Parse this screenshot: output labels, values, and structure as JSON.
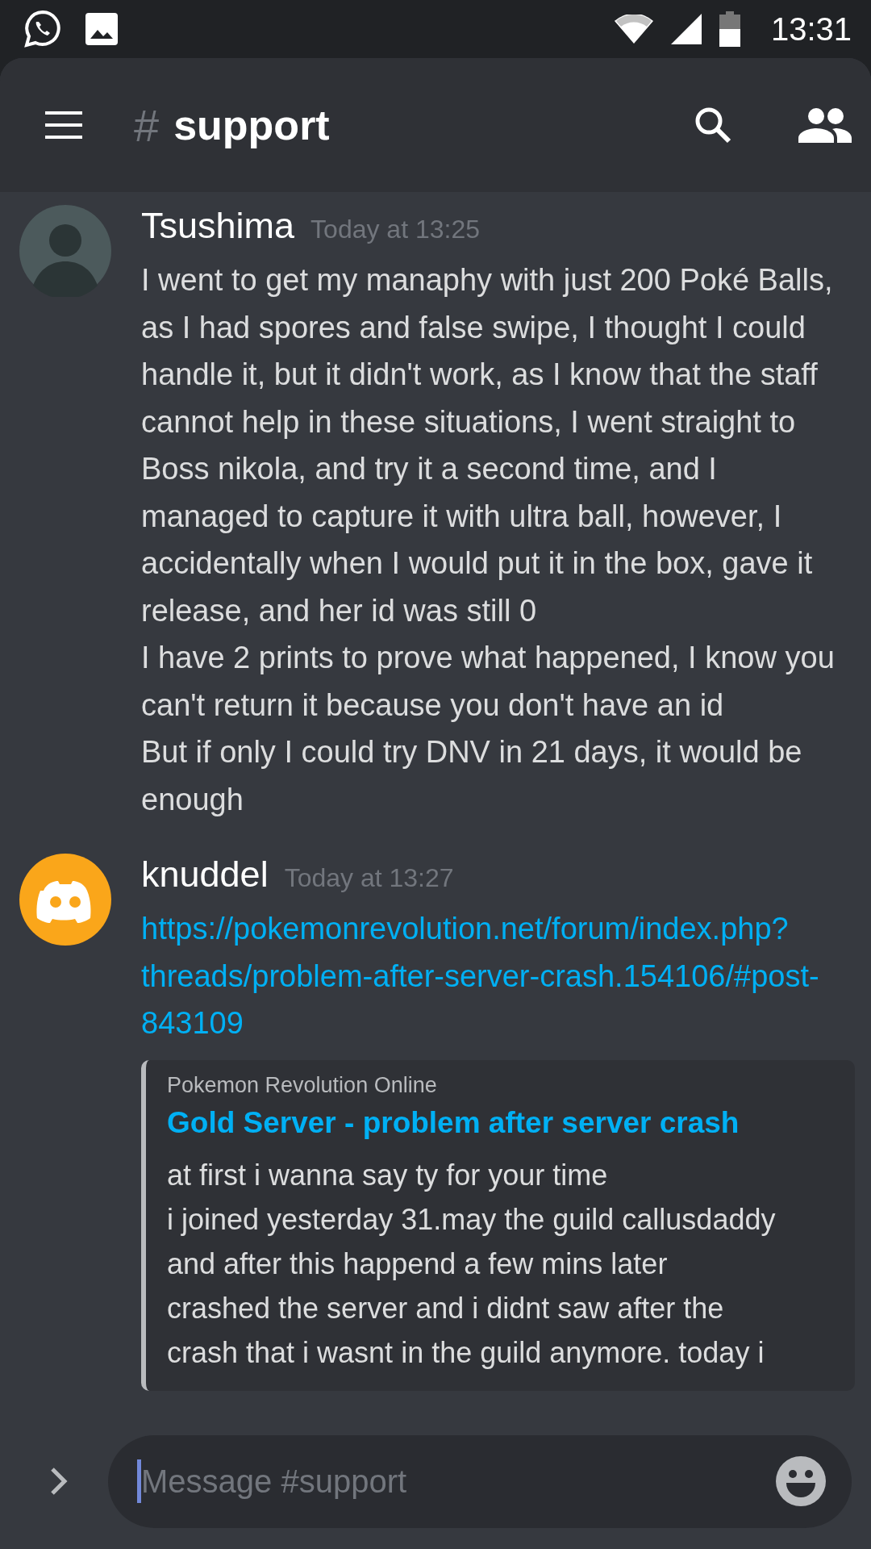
{
  "status_bar": {
    "time": "13:31"
  },
  "header": {
    "channel_prefix": "#",
    "channel": "support"
  },
  "messages": [
    {
      "kind": "text",
      "author": "Tsushima",
      "timestamp": "Today at 13:25",
      "paragraphs": [
        "I went to get my manaphy with just 200 Poké Balls, as I had spores and false swipe, I thought I could handle it, but it didn't work, as I know that the staff cannot help in these situations, I went straight to",
        "Boss nikola, and try it a second time, and I managed to capture it with ultra ball, however, I accidentally when I would put it in the box, gave it release, and her id was still 0",
        "I have 2 prints to prove what happened, I know you can't return it because you don't have an id",
        "But if only I could try DNV in 21 days, it would be enough"
      ]
    },
    {
      "kind": "link",
      "author": "knuddel",
      "timestamp": "Today at 13:27",
      "link": "https://pokemonrevolution.net/forum/index.php?threads/problem-after-server-crash.154106/#post-843109",
      "embed": {
        "provider": "Pokemon Revolution Online",
        "title": "Gold Server - problem after server crash",
        "description": [
          "at first i wanna say ty for your time",
          "i joined yesterday 31.may the guild callusdaddy",
          "and after this happend a few mins later",
          "crashed the server and i didnt saw after the",
          "crash that i wasnt in the guild anymore. today i"
        ]
      }
    }
  ],
  "composer": {
    "placeholder": "Message #support"
  }
}
